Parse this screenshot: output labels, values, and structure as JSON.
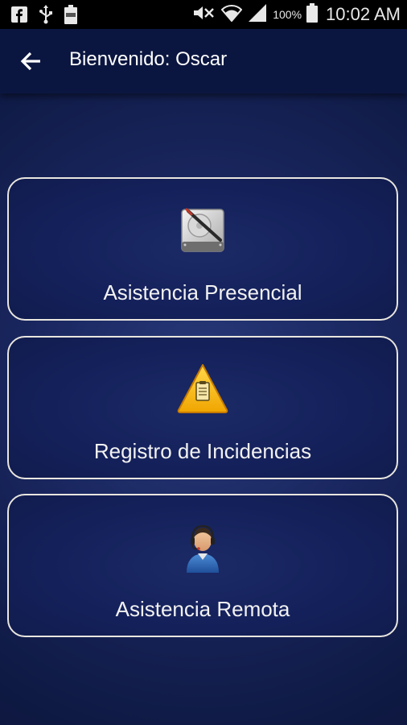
{
  "status_bar": {
    "battery_percent": "100%",
    "time": "10:02 AM",
    "left_icons": [
      "facebook-icon",
      "usb-icon",
      "battery-full-icon"
    ],
    "right_icons": [
      "mute-icon",
      "wifi-icon",
      "signal-icon",
      "battery-icon"
    ]
  },
  "app_bar": {
    "title": "Bienvenido: Oscar",
    "back_icon": "arrow-left-icon",
    "background": "#0b1640"
  },
  "menu": {
    "items": [
      {
        "label": "Asistencia Presencial",
        "icon": "hard-drive-tools-icon"
      },
      {
        "label": "Registro de Incidencias",
        "icon": "warning-clipboard-icon"
      },
      {
        "label": "Asistencia Remota",
        "icon": "support-agent-icon"
      }
    ]
  },
  "colors": {
    "card_border": "#e9e6df",
    "background_center": "#28397a",
    "background_edge": "#0a1336",
    "warning": "#f5b800"
  }
}
